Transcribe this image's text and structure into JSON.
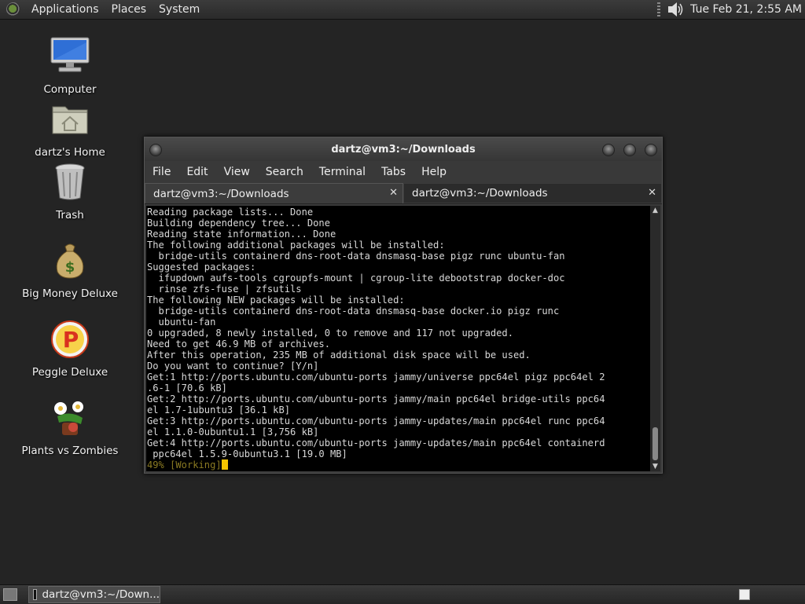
{
  "top_panel": {
    "menus": [
      "Applications",
      "Places",
      "System"
    ],
    "clock": "Tue Feb 21,  2:55 AM"
  },
  "desktop": {
    "icons": [
      {
        "label": "Computer",
        "icon": "computer-icon"
      },
      {
        "label": "dartz's Home",
        "icon": "home-folder-icon"
      },
      {
        "label": "Trash",
        "icon": "trash-icon"
      },
      {
        "label": "Big Money Deluxe",
        "icon": "money-bag-icon"
      },
      {
        "label": "Peggle Deluxe",
        "icon": "peggle-icon"
      },
      {
        "label": "Plants vs Zombies",
        "icon": "plants-vs-zombies-icon"
      }
    ]
  },
  "terminal": {
    "title": "dartz@vm3:~/Downloads",
    "menu": [
      "File",
      "Edit",
      "View",
      "Search",
      "Terminal",
      "Tabs",
      "Help"
    ],
    "tabs": [
      {
        "label": "dartz@vm3:~/Downloads",
        "active": true
      },
      {
        "label": "dartz@vm3:~/Downloads",
        "active": false
      }
    ],
    "output": "Reading package lists... Done\nBuilding dependency tree... Done\nReading state information... Done\nThe following additional packages will be installed:\n  bridge-utils containerd dns-root-data dnsmasq-base pigz runc ubuntu-fan\nSuggested packages:\n  ifupdown aufs-tools cgroupfs-mount | cgroup-lite debootstrap docker-doc\n  rinse zfs-fuse | zfsutils\nThe following NEW packages will be installed:\n  bridge-utils containerd dns-root-data dnsmasq-base docker.io pigz runc\n  ubuntu-fan\n0 upgraded, 8 newly installed, 0 to remove and 117 not upgraded.\nNeed to get 46.9 MB of archives.\nAfter this operation, 235 MB of additional disk space will be used.\nDo you want to continue? [Y/n]\nGet:1 http://ports.ubuntu.com/ubuntu-ports jammy/universe ppc64el pigz ppc64el 2\n.6-1 [70.6 kB]\nGet:2 http://ports.ubuntu.com/ubuntu-ports jammy/main ppc64el bridge-utils ppc64\nel 1.7-1ubuntu3 [36.1 kB]\nGet:3 http://ports.ubuntu.com/ubuntu-ports jammy-updates/main ppc64el runc ppc64\nel 1.1.0-0ubuntu1.1 [3,756 kB]\nGet:4 http://ports.ubuntu.com/ubuntu-ports jammy-updates/main ppc64el containerd\n ppc64el 1.5.9-0ubuntu3.1 [19.0 MB]",
    "status_line": "49% [Working]"
  },
  "bottom_panel": {
    "task_label": "dartz@vm3:~/Down..."
  }
}
